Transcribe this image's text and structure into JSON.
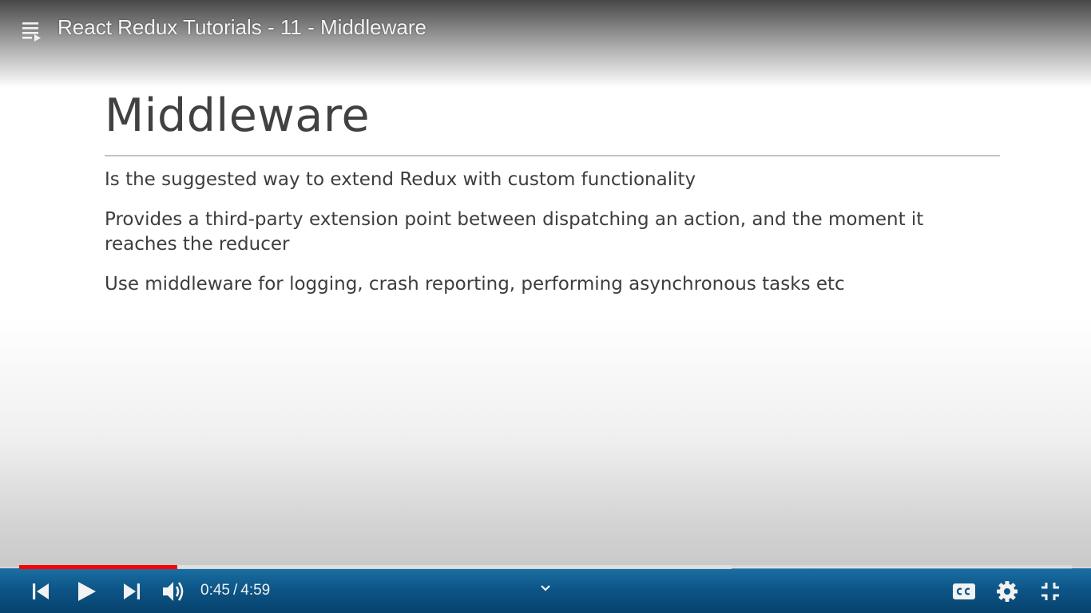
{
  "video": {
    "title": "React Redux Tutorials - 11 - Middleware"
  },
  "slide": {
    "heading": "Middleware",
    "bullets": [
      "Is the suggested way to extend Redux with custom functionality",
      "Provides a third-party extension point between dispatching an action, and the moment it reaches the reducer",
      "Use middleware for logging, crash reporting, performing asynchronous tasks etc"
    ]
  },
  "controls": {
    "current_time": "0:45",
    "separator": "/",
    "duration": "4:59",
    "progress_played_fraction": 0.1505,
    "progress_buffered_fraction": 0.677,
    "icons": {
      "playlist": "playlist-icon",
      "previous": "skip-previous-icon",
      "play": "play-icon",
      "next": "skip-next-icon",
      "volume": "volume-icon",
      "expand": "chevron-down-icon",
      "captions": "closed-captions-icon",
      "settings": "gear-icon",
      "exit_fullscreen": "exit-fullscreen-icon"
    }
  },
  "colors": {
    "progress_played": "#ff0000",
    "control_bar": "#0d5688",
    "slide_text": "#3d3d3d"
  }
}
